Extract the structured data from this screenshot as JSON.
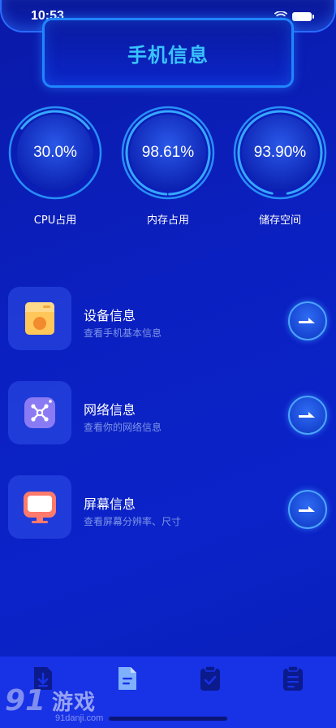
{
  "status_bar": {
    "time": "10:53"
  },
  "header": {
    "title": "手机信息"
  },
  "gauges": [
    {
      "value_text": "30.0%",
      "percent": 30.0,
      "label": "CPU占用"
    },
    {
      "value_text": "98.61%",
      "percent": 98.61,
      "label": "内存占用"
    },
    {
      "value_text": "93.90%",
      "percent": 93.9,
      "label": "储存空间"
    }
  ],
  "list": [
    {
      "title": "设备信息",
      "subtitle": "查看手机基本信息",
      "icon": "device-info-icon"
    },
    {
      "title": "网络信息",
      "subtitle": "查看你的网络信息",
      "icon": "network-info-icon"
    },
    {
      "title": "屏幕信息",
      "subtitle": "查看屏幕分辨率、尺寸",
      "icon": "screen-info-icon"
    }
  ],
  "tab_bar": {
    "tabs": [
      {
        "icon": "download-doc-icon",
        "active": false
      },
      {
        "icon": "document-icon",
        "active": true
      },
      {
        "icon": "clipboard-check-icon",
        "active": false
      },
      {
        "icon": "clipboard-list-icon",
        "active": false
      }
    ]
  },
  "watermark": {
    "number": "91",
    "brand": "游戏",
    "url": "91danji.com"
  },
  "colors": {
    "accent": "#39c3ff",
    "gauge_ring": "#2a9bff",
    "tab_inactive": "#0b1a8c",
    "tab_active": "#7fb0ff"
  }
}
